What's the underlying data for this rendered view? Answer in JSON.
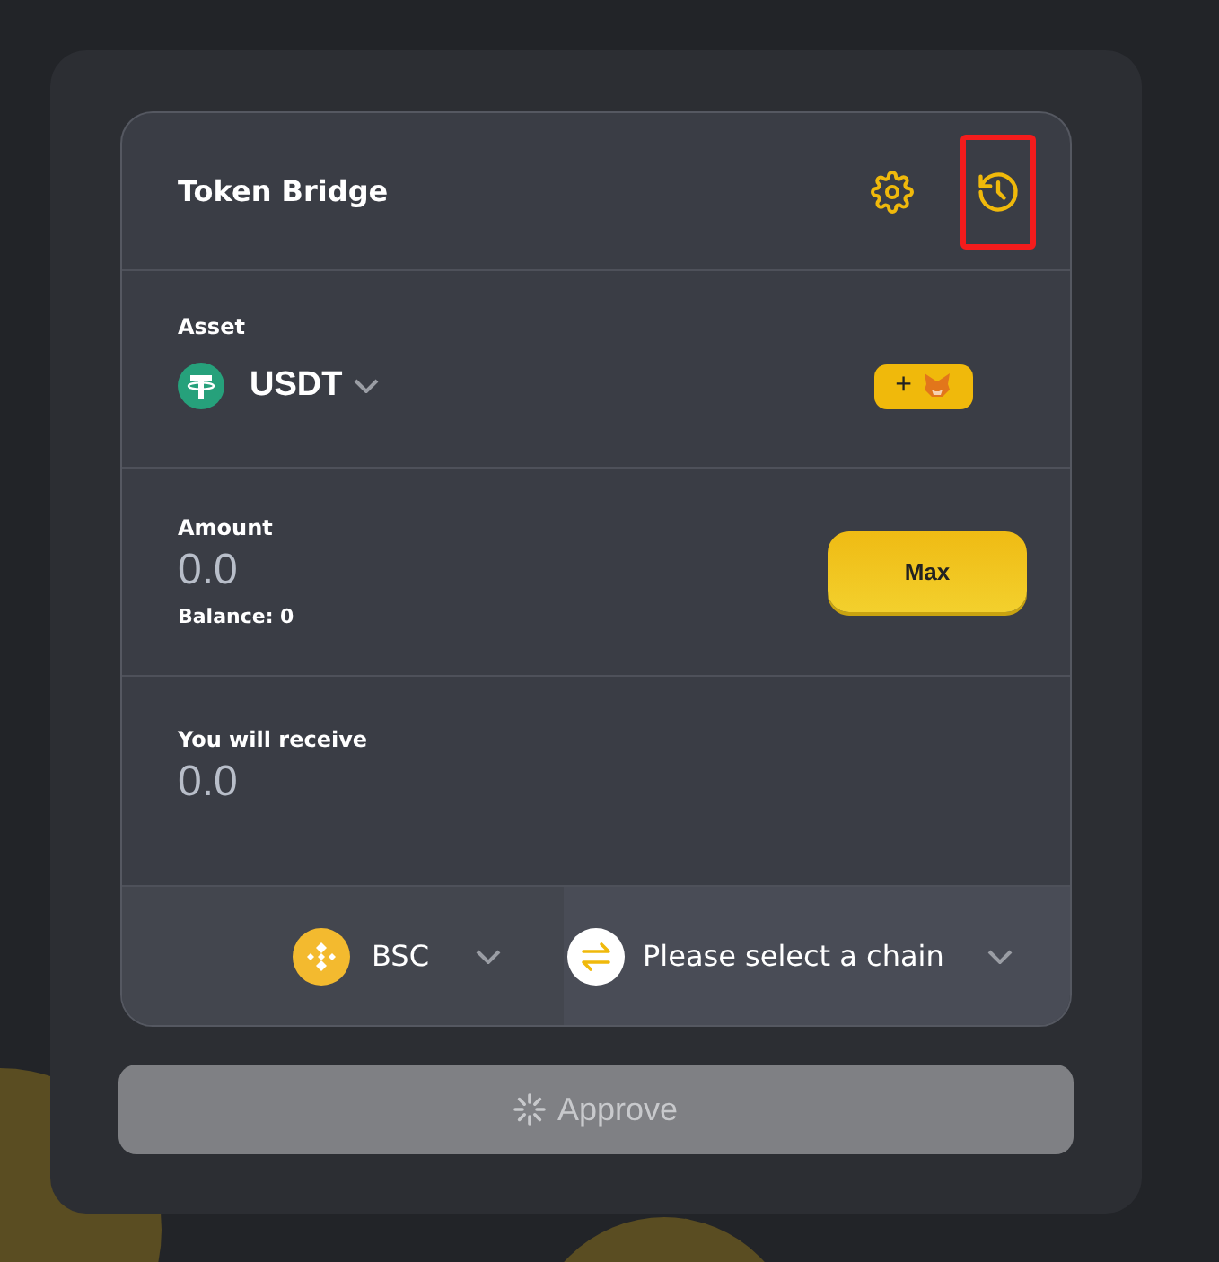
{
  "header": {
    "title": "Token Bridge",
    "history_highlighted": true
  },
  "asset": {
    "label": "Asset",
    "token": "USDT",
    "add_button": "+"
  },
  "amount": {
    "label": "Amount",
    "value": "0.0",
    "balance": "Balance: 0",
    "max_button": "Max"
  },
  "receive": {
    "label": "You will receive",
    "value": "0.0"
  },
  "chains": [
    {
      "kind": "bsc",
      "name": "BSC"
    },
    {
      "kind": "swap",
      "name": "Please select a chain"
    }
  ],
  "approve": {
    "label": "Approve",
    "disabled": true
  }
}
